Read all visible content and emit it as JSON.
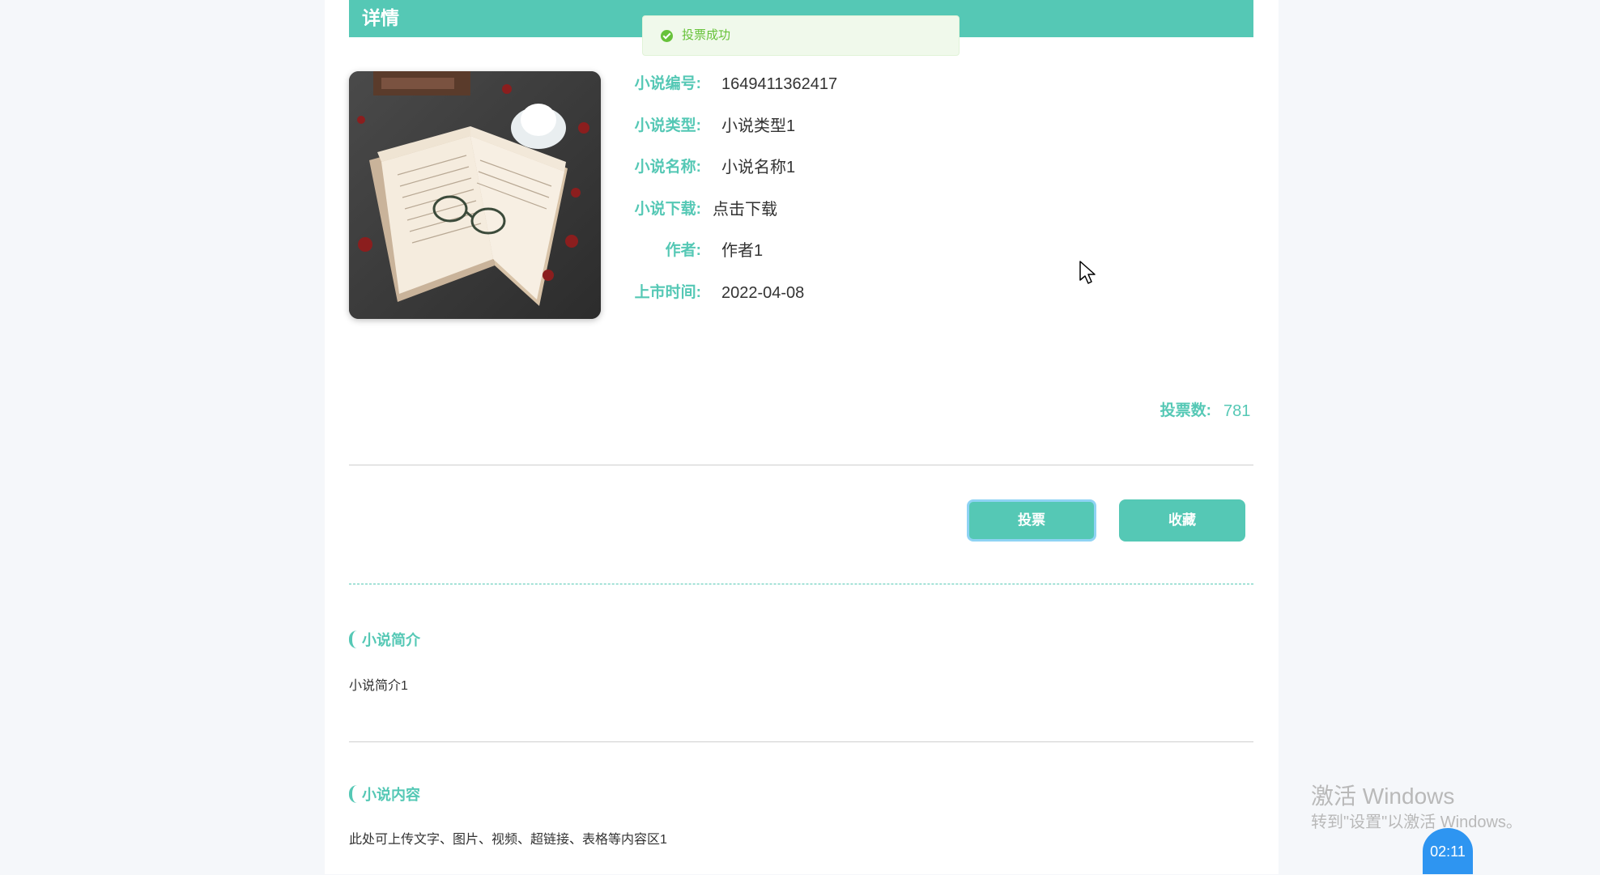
{
  "header": {
    "title": "详情"
  },
  "toast": {
    "message": "投票成功"
  },
  "details": [
    {
      "label": "小说编号:",
      "value": "1649411362417"
    },
    {
      "label": "小说类型:",
      "value": "小说类型1"
    },
    {
      "label": "小说名称:",
      "value": "小说名称1"
    },
    {
      "label": "小说下载:",
      "value": "点击下载"
    },
    {
      "label": "作者:",
      "value": "作者1"
    },
    {
      "label": "上市时间:",
      "value": "2022-04-08"
    }
  ],
  "votes": {
    "label": "投票数:",
    "value": "781"
  },
  "actions": {
    "vote_label": "投票",
    "favorite_label": "收藏"
  },
  "intro": {
    "title": "小说简介",
    "body": "小说简介1"
  },
  "content": {
    "title": "小说内容",
    "body": "此处可上传文字、图片、视频、超链接、表格等内容区1"
  },
  "watermark": {
    "title": "激活 Windows",
    "subtitle": "转到\"设置\"以激活 Windows。"
  },
  "timer": {
    "value": "02:11"
  },
  "colors": {
    "accent": "#55c8b5",
    "success": "#67c23a",
    "timer": "#2e95f1"
  },
  "icons": {
    "toast": "check-circle-icon",
    "cursor": "mouse-pointer-icon"
  }
}
